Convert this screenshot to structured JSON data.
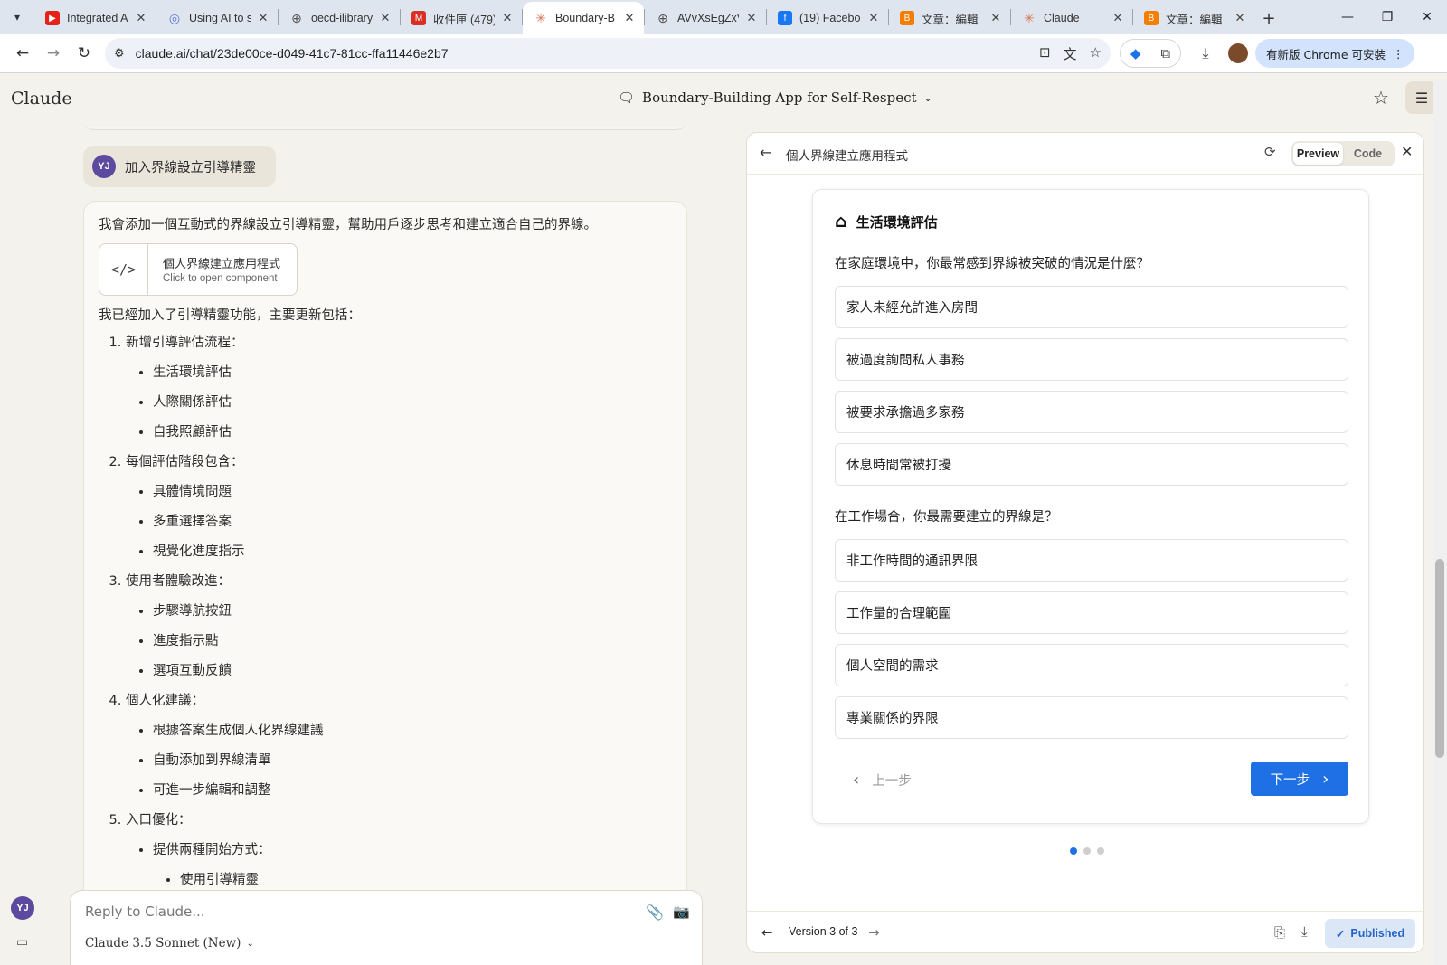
{
  "browser": {
    "tabs": [
      {
        "title": "Integrated A",
        "icon": "youtube-icon",
        "color": "#e62117"
      },
      {
        "title": "Using AI to s",
        "icon": "ai-tools-icon",
        "color": "#5a7bd5"
      },
      {
        "title": "oecd-ilibrary",
        "icon": "globe-icon",
        "color": "#555555"
      },
      {
        "title": "收件匣 (479)",
        "icon": "gmail-icon",
        "color": "#d93025"
      },
      {
        "title": "Boundary-B",
        "icon": "claude-icon",
        "color": "#d97757",
        "active": true
      },
      {
        "title": "AVvXsEgZxV",
        "icon": "globe-icon",
        "color": "#555555"
      },
      {
        "title": "(19) Facebo",
        "icon": "facebook-icon",
        "color": "#1877f2"
      },
      {
        "title": "文章：編輯",
        "icon": "blogger-icon",
        "color": "#f57d00"
      },
      {
        "title": "Claude",
        "icon": "claude-icon",
        "color": "#d97757"
      },
      {
        "title": "文章：編輯",
        "icon": "blogger-icon",
        "color": "#f57d00"
      }
    ],
    "url": "claude.ai/chat/23de00ce-d049-41c7-81cc-ffa11446e2b7",
    "update_label": "有新版 Chrome 可安裝"
  },
  "app": {
    "brand": "Claude",
    "chat_title": "Boundary-Building App for Self-Respect"
  },
  "chat": {
    "user_initials": "YJ",
    "user_message": "加入界線設立引導精靈",
    "assistant_intro": "我會添加一個互動式的界線設立引導精靈，幫助用戶逐步思考和建立適合自己的界線。",
    "artifact": {
      "name": "個人界線建立應用程式",
      "sub": "Click to open component"
    },
    "updates_lead": "我已經加入了引導精靈功能，主要更新包括：",
    "updates": [
      {
        "title": "新增引導評估流程：",
        "items": [
          "生活環境評估",
          "人際關係評估",
          "自我照顧評估"
        ]
      },
      {
        "title": "每個評估階段包含：",
        "items": [
          "具體情境問題",
          "多重選擇答案",
          "視覺化進度指示"
        ]
      },
      {
        "title": "使用者體驗改進：",
        "items": [
          "步驟導航按鈕",
          "進度指示點",
          "選項互動反饋"
        ]
      },
      {
        "title": "個人化建議：",
        "items": [
          "根據答案生成個人化界線建議",
          "自動添加到界線清單",
          "可進一步編輯和調整"
        ]
      },
      {
        "title": "入口優化：",
        "items": [
          "提供兩種開始方式："
        ],
        "nested": [
          "使用引導精靈"
        ]
      }
    ]
  },
  "reply": {
    "placeholder": "Reply to Claude...",
    "model": "Claude 3.5 Sonnet (New)"
  },
  "artifact_panel": {
    "title": "個人界線建立應用程式",
    "preview_label": "Preview",
    "code_label": "Code",
    "wizard": {
      "section_title": "生活環境評估",
      "q1": "在家庭環境中，你最常感到界線被突破的情況是什麼？",
      "q1_options": [
        "家人未經允許進入房間",
        "被過度詢問私人事務",
        "被要求承擔過多家務",
        "休息時間常被打擾"
      ],
      "q2": "在工作場合，你最需要建立的界線是？",
      "q2_options": [
        "非工作時間的通訊界限",
        "工作量的合理範圍",
        "個人空間的需求",
        "專業關係的界限"
      ],
      "prev_label": "上一步",
      "next_label": "下一步",
      "steps_total": 3,
      "current_step": 1
    },
    "version_label": "Version 3 of 3",
    "published_label": "Published"
  }
}
